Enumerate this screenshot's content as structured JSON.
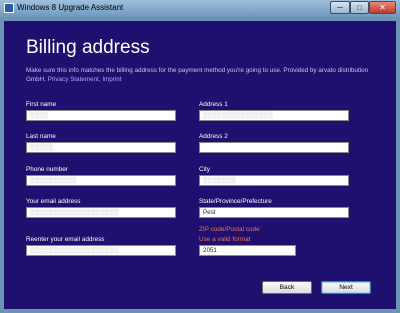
{
  "window": {
    "title": "Windows 8 Upgrade Assistant",
    "controls": {
      "minimize": "─",
      "maximize": "□",
      "close": "✕"
    }
  },
  "page": {
    "heading": "Billing address",
    "description": "Make sure this info matches the billing address for the payment method you're going to use. Provided by arvato distribution GmbH.",
    "links": {
      "privacy": "Privacy Statement",
      "imprint": "Imprint"
    }
  },
  "form": {
    "first_name": {
      "label": "First name",
      "value": "▒▒▒▒"
    },
    "last_name": {
      "label": "Last name",
      "value": "▒▒▒▒▒"
    },
    "phone": {
      "label": "Phone number",
      "value": "▒▒▒▒▒▒▒▒▒▒"
    },
    "email": {
      "label": "Your email address",
      "value": "▒▒▒▒▒▒▒▒▒▒▒▒▒▒▒▒▒▒▒"
    },
    "email_confirm": {
      "label": "Reenter your email address",
      "value": "▒▒▒▒▒▒▒▒▒▒▒▒▒▒▒▒▒▒▒"
    },
    "address1": {
      "label": "Address 1",
      "value": "▒▒▒▒▒▒▒▒▒▒▒▒▒▒▒"
    },
    "address2": {
      "label": "Address 2",
      "value": ""
    },
    "city": {
      "label": "City",
      "value": "▒▒▒▒▒▒▒"
    },
    "state": {
      "label": "State/Province/Prefecture",
      "value": "Pest"
    },
    "zip": {
      "label": "ZIP code/Postal code",
      "error": "Use a valid format",
      "value": "2051"
    }
  },
  "buttons": {
    "back": "Back",
    "next": "Next"
  },
  "colors": {
    "background": "#1f0f6e",
    "error": "#e8735a",
    "link": "#b4a6ff"
  }
}
